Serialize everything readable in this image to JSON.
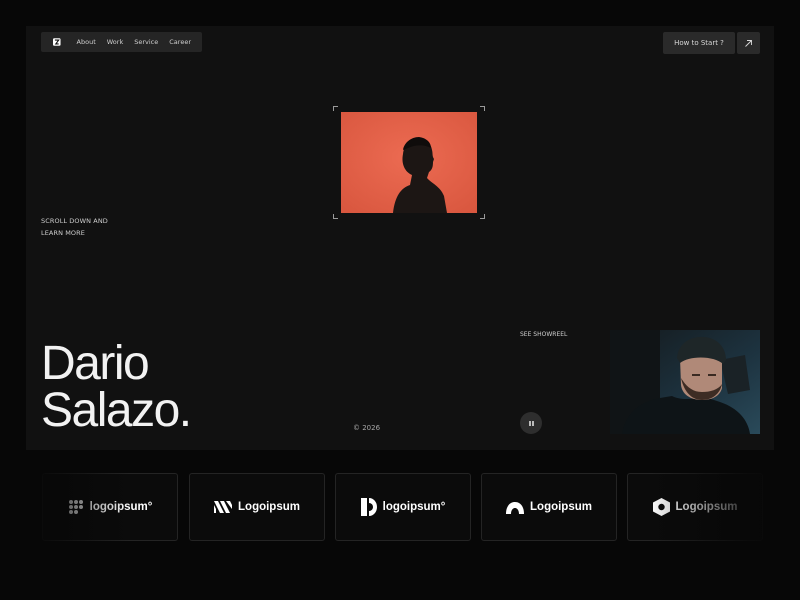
{
  "nav": {
    "logo_icon": "brand-logo-icon",
    "links": [
      "About",
      "Work",
      "Service",
      "Career"
    ]
  },
  "header": {
    "cta_label": "How to Start ?",
    "cta_icon": "arrow-up-right-icon"
  },
  "hero": {
    "scroll_hint_line1": "SCROLL DOWN AND",
    "scroll_hint_line2": "LEARN MORE",
    "name_line1": "Dario",
    "name_line2": "Salazo.",
    "portrait_bg": "#e36249",
    "showreel_label": "SEE SHOWREEL",
    "copyright": "© 2026",
    "pause_icon": "pause-icon"
  },
  "logos": [
    {
      "text": "logoipsum",
      "icon": "dots-grid-icon",
      "suffix": "°"
    },
    {
      "text": "Logoipsum",
      "icon": "stripes-n-icon",
      "suffix": ""
    },
    {
      "text": "logoipsum",
      "icon": "split-circle-icon",
      "suffix": "°"
    },
    {
      "text": "Logoipsum",
      "icon": "cloud-arch-icon",
      "suffix": ""
    },
    {
      "text": "Logoipsum",
      "icon": "hexagon-icon",
      "suffix": ""
    }
  ],
  "colors": {
    "page_bg": "#070707",
    "hero_bg": "#111111",
    "accent": "#e36249"
  }
}
